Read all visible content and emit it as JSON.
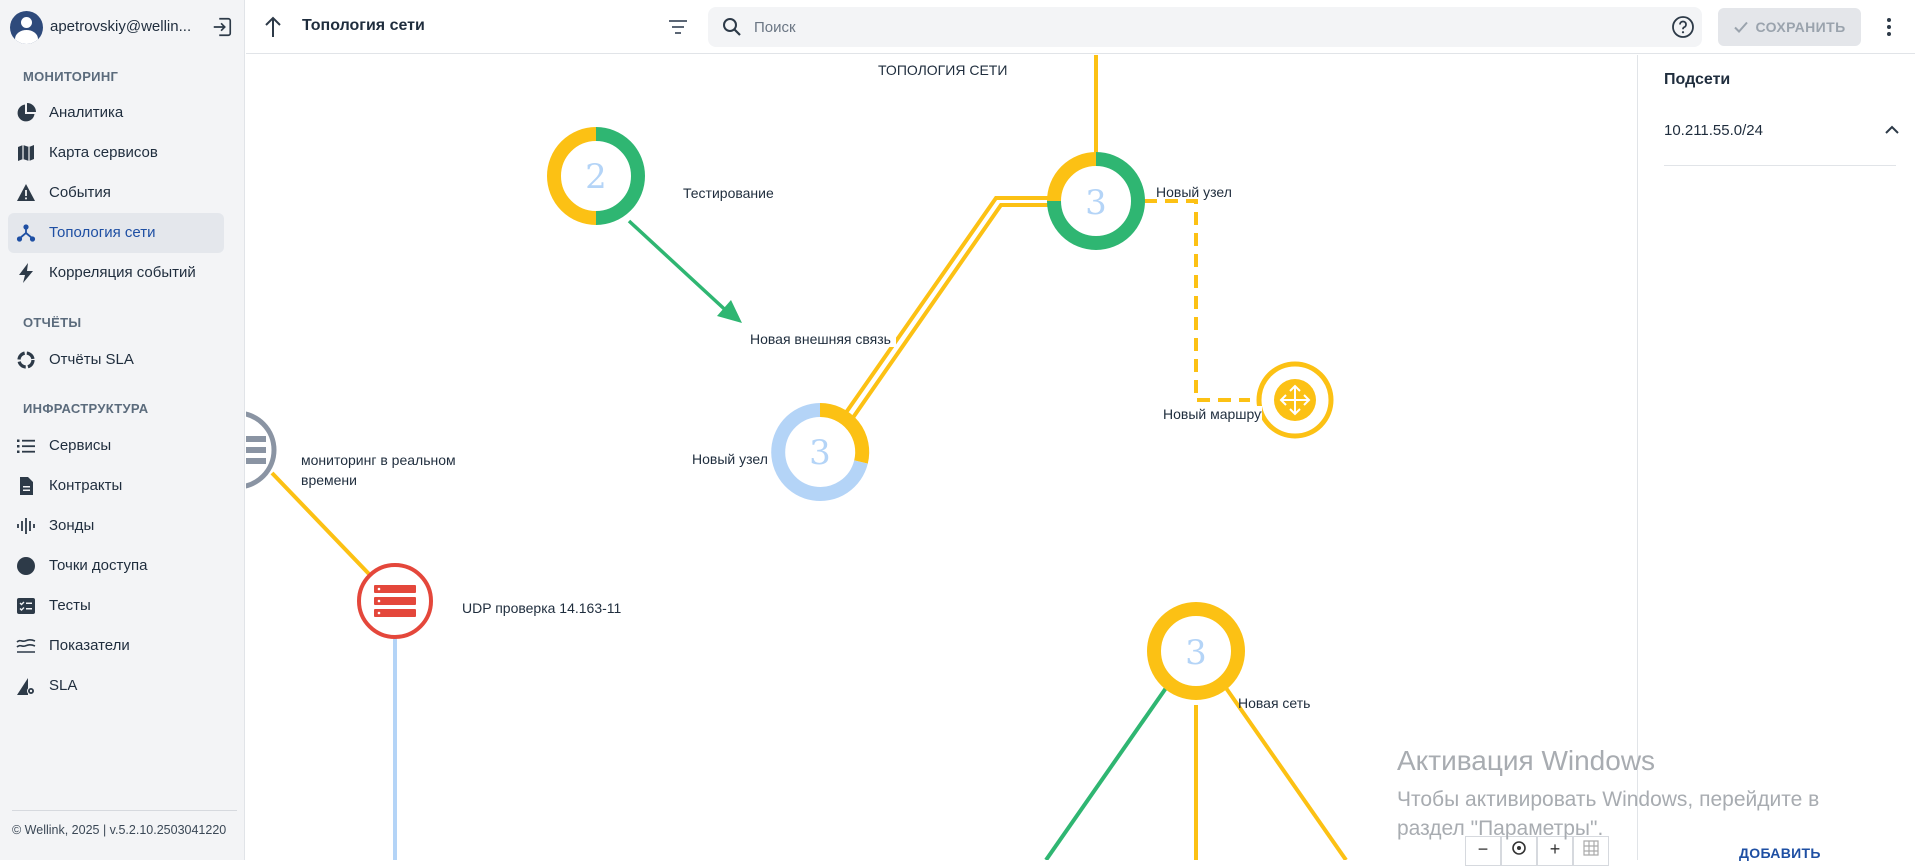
{
  "user": {
    "name": "apetrovskiy@wellin..."
  },
  "sidebar": {
    "sections": [
      {
        "title": "МОНИТОРИНГ",
        "items": [
          "Аналитика",
          "Карта сервисов",
          "События",
          "Топология сети",
          "Корреляция событий"
        ]
      },
      {
        "title": "ОТЧЁТЫ",
        "items": [
          "Отчёты SLA"
        ]
      },
      {
        "title": "ИНФРАСТРУКТУРА",
        "items": [
          "Сервисы",
          "Контракты",
          "Зонды",
          "Точки доступа",
          "Тесты",
          "Показатели",
          "SLA"
        ]
      }
    ],
    "active": "Топология сети",
    "footer": "© Wellink, 2025 | v.5.2.10.2503041220"
  },
  "topbar": {
    "title": "Топология сети",
    "search_placeholder": "Поиск",
    "save_label": "СОХРАНИТЬ"
  },
  "canvas": {
    "heading": "ТОПОЛОГИЯ СЕТИ",
    "nodes": {
      "testing": {
        "label": "Тестирование",
        "count": "2"
      },
      "node_top": {
        "label": "Новый узел",
        "count": "3"
      },
      "ext_link": {
        "label": "Новая внешняя связь"
      },
      "node_mid": {
        "label": "Новый узел",
        "count": "3"
      },
      "router": {
        "label": "Новый маршрутизатор"
      },
      "monitoring": {
        "label": "мониторинг в реальном времени"
      },
      "udp": {
        "label": "UDP проверка 14.163-11"
      },
      "network": {
        "label": "Новая сеть",
        "count": "3"
      }
    },
    "zoom": {
      "minus": "−",
      "plus": "+"
    }
  },
  "right_panel": {
    "title": "Подсети",
    "subnet": "10.211.55.0/24",
    "add_label": "ДОБАВИТЬ"
  },
  "watermark": {
    "title": "Активация Windows",
    "line1": "Чтобы активировать Windows, перейдите в",
    "line2": "раздел \"Параметры\"."
  },
  "colors": {
    "green": "#2fb672",
    "yellow": "#fcc114",
    "light_blue": "#b4d4f7",
    "red": "#e4473b",
    "gray": "#8a94a3",
    "accent": "#1e4fa3"
  }
}
